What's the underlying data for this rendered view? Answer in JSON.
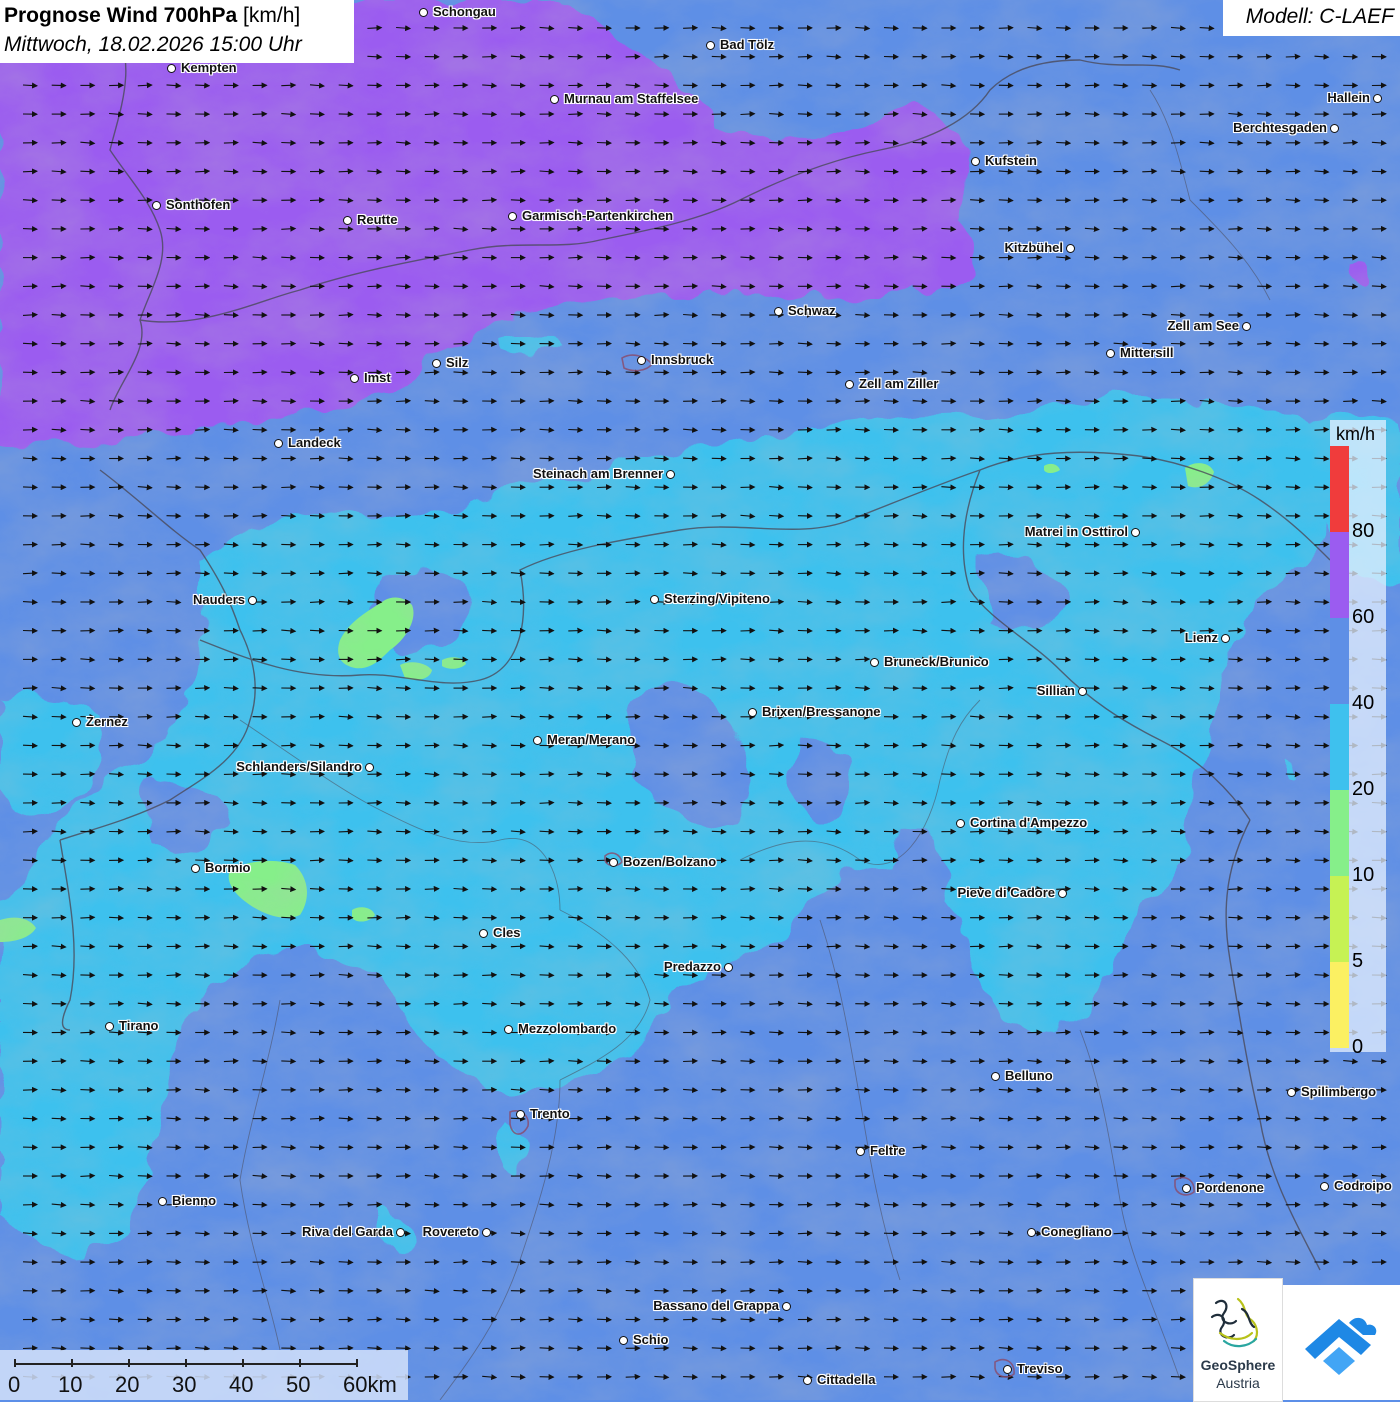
{
  "title": {
    "main_bold": "Prognose Wind 700hPa",
    "main_unit": " [km/h]",
    "datetime": "Mittwoch, 18.02.2026 15:00 Uhr"
  },
  "model": "Modell: C-LAEF",
  "legend": {
    "unit": "km/h",
    "classes": [
      {
        "label": "",
        "color": "#f03c3c"
      },
      {
        "label": "80",
        "color": "#9b5cf0"
      },
      {
        "label": "60",
        "color": "#5e8fe6"
      },
      {
        "label": "40",
        "color": "#3ec1ee"
      },
      {
        "label": "20",
        "color": "#86ef8a"
      },
      {
        "label": "10",
        "color": "#c6f254"
      },
      {
        "label": "5",
        "color": "#fbf062"
      },
      {
        "label": "0",
        "color": ""
      }
    ]
  },
  "scale_bar": {
    "labels": [
      "0",
      "10",
      "20",
      "30",
      "40",
      "50",
      "60km"
    ]
  },
  "logos": {
    "geosphere_line1": "GeoSphere",
    "geosphere_line2": "Austria"
  },
  "wind_direction": "west-to-east",
  "cities": [
    {
      "name": "Schongau",
      "label_side": "right"
    },
    {
      "name": "Bad Tölz",
      "label_side": "right"
    },
    {
      "name": "Kempten",
      "label_side": "right"
    },
    {
      "name": "Murnau am Staffelsee",
      "label_side": "right"
    },
    {
      "name": "Hallein",
      "label_side": "left"
    },
    {
      "name": "Berchtesgaden",
      "label_side": "left"
    },
    {
      "name": "Kufstein",
      "label_side": "right"
    },
    {
      "name": "Sonthofen",
      "label_side": "right"
    },
    {
      "name": "Reutte",
      "label_side": "right"
    },
    {
      "name": "Garmisch-Partenkirchen",
      "label_side": "right"
    },
    {
      "name": "Kitzbühel",
      "label_side": "left"
    },
    {
      "name": "Schwaz",
      "label_side": "right"
    },
    {
      "name": "Zell am See",
      "label_side": "left"
    },
    {
      "name": "Mittersill",
      "label_side": "right"
    },
    {
      "name": "Innsbruck",
      "label_side": "right"
    },
    {
      "name": "Silz",
      "label_side": "right"
    },
    {
      "name": "Imst",
      "label_side": "right"
    },
    {
      "name": "Zell am Ziller",
      "label_side": "right"
    },
    {
      "name": "Landeck",
      "label_side": "right"
    },
    {
      "name": "Steinach am Brenner",
      "label_side": "left"
    },
    {
      "name": "Matrei in Osttirol",
      "label_side": "left"
    },
    {
      "name": "Nauders",
      "label_side": "left"
    },
    {
      "name": "Sterzing/Vipiteno",
      "label_side": "right"
    },
    {
      "name": "Lienz",
      "label_side": "left"
    },
    {
      "name": "Bruneck/Brunico",
      "label_side": "right"
    },
    {
      "name": "Sillian",
      "label_side": "left"
    },
    {
      "name": "Brixen/Bressanone",
      "label_side": "right"
    },
    {
      "name": "Zernez",
      "label_side": "right"
    },
    {
      "name": "Meran/Merano",
      "label_side": "right"
    },
    {
      "name": "Schlanders/Silandro",
      "label_side": "left"
    },
    {
      "name": "Cortina d'Ampezzo",
      "label_side": "right"
    },
    {
      "name": "Bozen/Bolzano",
      "label_side": "right"
    },
    {
      "name": "Bormio",
      "label_side": "right"
    },
    {
      "name": "Pieve di Cadore",
      "label_side": "left"
    },
    {
      "name": "Cles",
      "label_side": "right"
    },
    {
      "name": "Predazzo",
      "label_side": "left"
    },
    {
      "name": "Tirano",
      "label_side": "right"
    },
    {
      "name": "Mezzolombardo",
      "label_side": "right"
    },
    {
      "name": "Belluno",
      "label_side": "right"
    },
    {
      "name": "Spilimbergo",
      "label_side": "right"
    },
    {
      "name": "Trento",
      "label_side": "right"
    },
    {
      "name": "Feltre",
      "label_side": "right"
    },
    {
      "name": "Pordenone",
      "label_side": "right"
    },
    {
      "name": "Codroipo",
      "label_side": "right"
    },
    {
      "name": "Bienno",
      "label_side": "right"
    },
    {
      "name": "Riva del Garda",
      "label_side": "left"
    },
    {
      "name": "Rovereto",
      "label_side": "left"
    },
    {
      "name": "Conegliano",
      "label_side": "right"
    },
    {
      "name": "Bassano del Grappa",
      "label_side": "left"
    },
    {
      "name": "Schio",
      "label_side": "right"
    },
    {
      "name": "Treviso",
      "label_side": "right"
    },
    {
      "name": "Cittadella",
      "label_side": "right"
    }
  ]
}
